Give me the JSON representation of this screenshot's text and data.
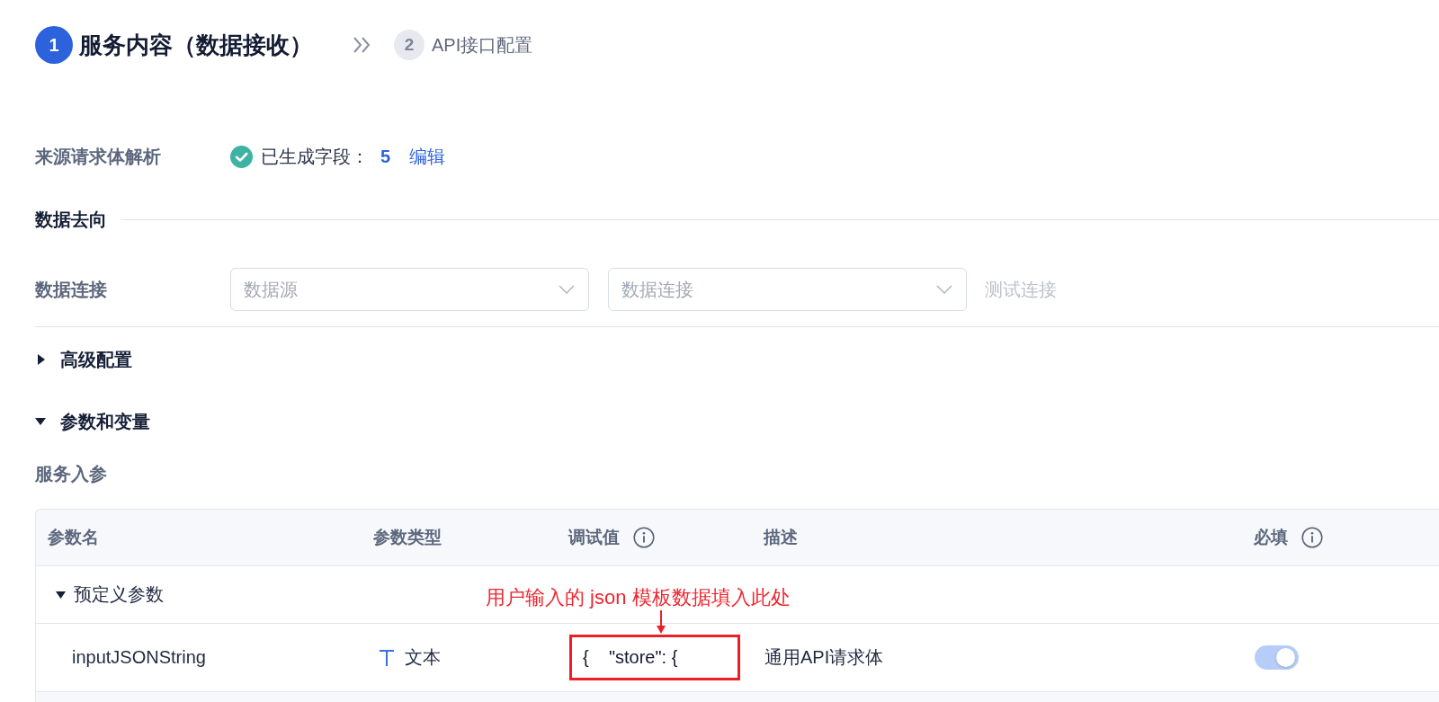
{
  "steps": [
    {
      "number": "1",
      "label": "服务内容（数据接收）",
      "selected": true
    },
    {
      "number": "2",
      "label": "API接口配置",
      "selected": false
    }
  ],
  "source_parse": {
    "label": "来源请求体解析",
    "status": "已生成字段：",
    "count": "5",
    "link": "编辑"
  },
  "data_destination": {
    "title": "数据去向",
    "connection": {
      "label": "数据连接",
      "selects": [
        {
          "placeholder": "数据源"
        },
        {
          "placeholder": "数据连接"
        }
      ],
      "test_button": {
        "label": "测试连接",
        "disabled": true
      }
    }
  },
  "sections": [
    {
      "title": "高级配置",
      "expanded": false
    },
    {
      "title": "参数和变量",
      "expanded": true
    }
  ],
  "service_params": {
    "title": "服务入参",
    "table": {
      "columns": [
        {
          "label": "参数名",
          "info": false
        },
        {
          "label": "参数类型",
          "info": false
        },
        {
          "label": "调试值",
          "info": true
        },
        {
          "label": "描述",
          "info": false
        },
        {
          "label": "必填",
          "info": true
        }
      ],
      "groups": [
        {
          "label": "预定义参数",
          "expanded": true,
          "rows": [
            {
              "name": "inputJSONString",
              "type": "文本",
              "debug_value": "{    \"store\": {",
              "description": "通用API请求体",
              "required": {
                "on": true,
                "disabled": true
              }
            }
          ]
        }
      ]
    }
  },
  "annotation": {
    "text": "用户输入的 json 模板数据填入此处"
  }
}
